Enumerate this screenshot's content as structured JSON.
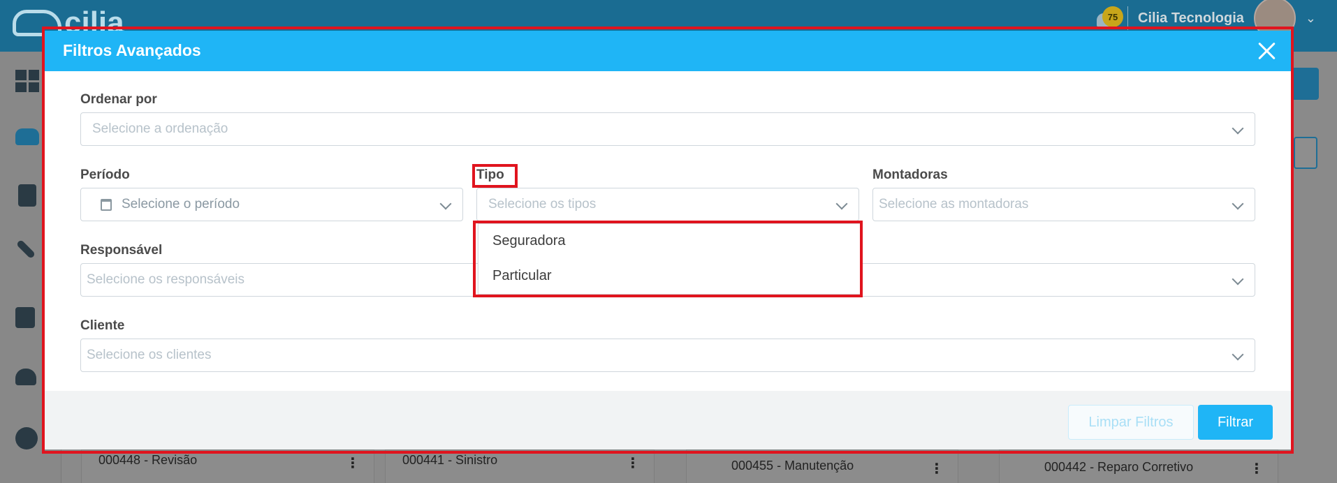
{
  "app": {
    "logo_text": "cilia",
    "notification_count": "75",
    "company": "Cilia Tecnologia"
  },
  "background_cards": [
    {
      "label": "000448 - Revisão"
    },
    {
      "label": "000441 - Sinistro"
    },
    {
      "label": "000455 - Manutenção"
    },
    {
      "label": "000442 - Reparo Corretivo"
    }
  ],
  "modal": {
    "title": "Filtros Avançados",
    "fields": {
      "ordenar": {
        "label": "Ordenar por",
        "placeholder": "Selecione a ordenação"
      },
      "periodo": {
        "label": "Período",
        "placeholder": "Selecione o período"
      },
      "tipo": {
        "label": "Tipo",
        "placeholder": "Selecione os tipos"
      },
      "montadoras": {
        "label": "Montadoras",
        "placeholder": "Selecione as montadoras"
      },
      "responsavel": {
        "label": "Responsável",
        "placeholder": "Selecione os responsáveis"
      },
      "cliente": {
        "label": "Cliente",
        "placeholder": "Selecione os clientes"
      }
    },
    "tipo_options": [
      "Seguradora",
      "Particular"
    ],
    "buttons": {
      "clear": "Limpar Filtros",
      "filter": "Filtrar"
    }
  },
  "colors": {
    "header": "#1fb5f6",
    "highlight": "#e0141e"
  }
}
